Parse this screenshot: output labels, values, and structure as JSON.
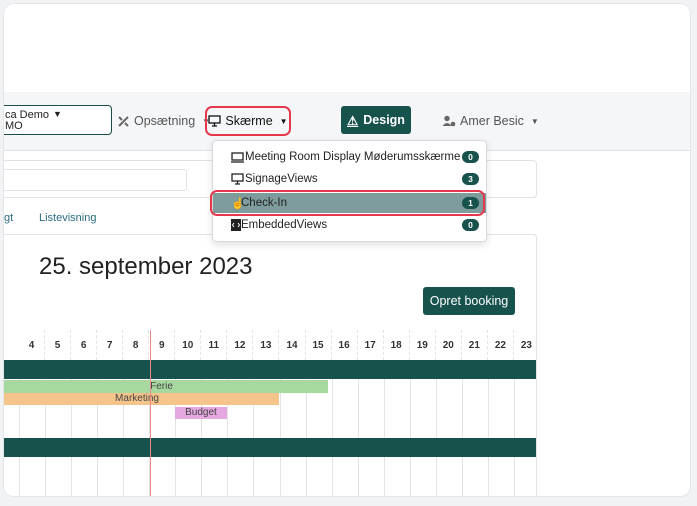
{
  "org": {
    "line1": "ca Demo",
    "line2": "MO"
  },
  "nav": {
    "setup_label": "Opsætning",
    "screens_label": "Skærme",
    "design_label": "Design",
    "user_label": "Amer Besic"
  },
  "tabs": {
    "partial": "gt",
    "list_view": "Listevisning"
  },
  "calendar": {
    "date_title": "25. september 2023",
    "create_booking": "Opret booking",
    "hours": [
      "4",
      "5",
      "6",
      "7",
      "8",
      "9",
      "10",
      "11",
      "12",
      "13",
      "14",
      "15",
      "16",
      "17",
      "18",
      "19",
      "20",
      "21",
      "22",
      "23"
    ],
    "bookings": [
      {
        "label": "Ferie",
        "color": "#a7d8a0"
      },
      {
        "label": "Marketing",
        "color": "#f5c48a"
      },
      {
        "label": "Budget",
        "color": "#e6a8e0"
      }
    ]
  },
  "dropdown": {
    "items": [
      {
        "label": "Meeting Room Display Møderumsskærme",
        "count": "0",
        "icon": "monitor-icon"
      },
      {
        "label": "SignageViews",
        "count": "3",
        "icon": "desktop-icon"
      },
      {
        "label": "Check-In",
        "count": "1",
        "icon": "hand-pointer-icon",
        "highlighted": true
      },
      {
        "label": "EmbeddedViews",
        "count": "0",
        "icon": "code-file-icon"
      }
    ]
  },
  "colors": {
    "brand": "#17524c",
    "highlight": "#e5384d"
  }
}
